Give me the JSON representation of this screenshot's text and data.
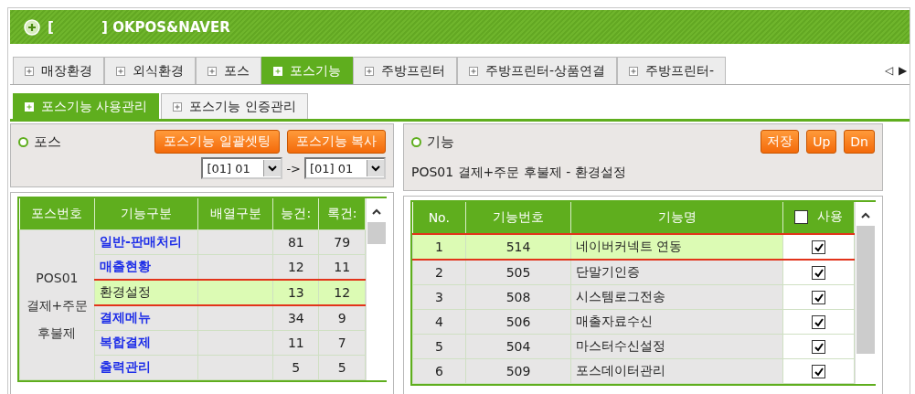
{
  "header": {
    "title": "[          ] OKPOS&NAVER"
  },
  "tabs": [
    {
      "label": "매장환경",
      "selected": false
    },
    {
      "label": "외식환경",
      "selected": false
    },
    {
      "label": "포스",
      "selected": false
    },
    {
      "label": "포스기능",
      "selected": true
    },
    {
      "label": "주방프린터",
      "selected": false
    },
    {
      "label": "주방프린터-상품연결",
      "selected": false
    },
    {
      "label": "주방프린터-",
      "selected": false
    }
  ],
  "tab_scroll": [
    "◁",
    "▶"
  ],
  "subtabs": [
    {
      "label": "포스기능 사용관리",
      "selected": true
    },
    {
      "label": "포스기능 인증관리",
      "selected": false
    }
  ],
  "pos_panel": {
    "title": "포스",
    "buttons": [
      "포스기능 일괄셋팅",
      "포스기능 복사"
    ],
    "from": "[01] 01",
    "arrow": "->",
    "to": "[01] 01",
    "columns": [
      "포스번호",
      "기능구분",
      "배열구분",
      "능건:",
      "록건:"
    ],
    "group": [
      "POS01",
      "결제+주문",
      "후불제"
    ],
    "rows": [
      {
        "name": "일반-판매처리",
        "count_a": "81",
        "count_b": "79",
        "selected": false
      },
      {
        "name": "매출현황",
        "count_a": "12",
        "count_b": "11",
        "selected": false
      },
      {
        "name": "환경설정",
        "count_a": "13",
        "count_b": "12",
        "selected": true
      },
      {
        "name": "결제메뉴",
        "count_a": "34",
        "count_b": "9",
        "selected": false
      },
      {
        "name": "복합결제",
        "count_a": "11",
        "count_b": "7",
        "selected": false
      },
      {
        "name": "출력관리",
        "count_a": "5",
        "count_b": "5",
        "selected": false
      }
    ]
  },
  "function_panel": {
    "title": "기능",
    "buttons": [
      "저장",
      "Up",
      "Dn"
    ],
    "subtitle": "POS01 결제+주문 후불제 - 환경설정",
    "columns": [
      "No.",
      "기능번호",
      "기능명",
      "사용"
    ],
    "all_checked": false,
    "rows": [
      {
        "no": "1",
        "code": "514",
        "name": "네이버커넥트 연동",
        "checked": true,
        "selected": true
      },
      {
        "no": "2",
        "code": "505",
        "name": "단말기인증",
        "checked": true,
        "selected": false
      },
      {
        "no": "3",
        "code": "508",
        "name": "시스템로그전송",
        "checked": true,
        "selected": false
      },
      {
        "no": "4",
        "code": "506",
        "name": "매출자료수신",
        "checked": true,
        "selected": false
      },
      {
        "no": "5",
        "code": "504",
        "name": "마스터수신설정",
        "checked": true,
        "selected": false
      },
      {
        "no": "6",
        "code": "509",
        "name": "포스데이터관리",
        "checked": true,
        "selected": false
      }
    ]
  }
}
